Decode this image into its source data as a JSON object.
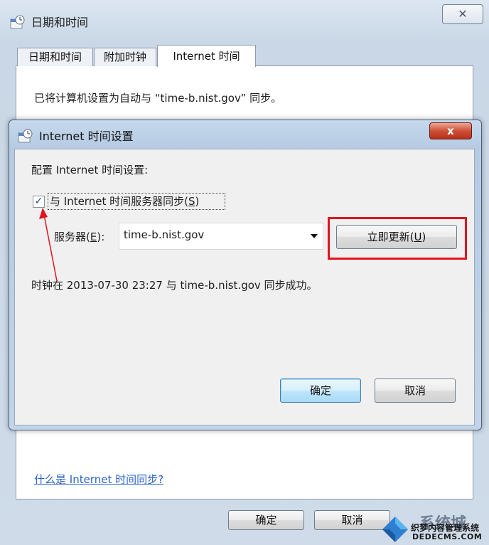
{
  "outer_dialog": {
    "title": "日期和时间",
    "close_symbol": "✕",
    "tabs": [
      {
        "label": "日期和时间"
      },
      {
        "label": "附加时钟"
      },
      {
        "label": "Internet 时间"
      }
    ],
    "sync_description": "已将计算机设置为自动与 “time-b.nist.gov” 同步。",
    "help_link": "什么是 Internet 时间同步?",
    "ok_label": "确定",
    "cancel_label": "取消"
  },
  "inner_dialog": {
    "title": "Internet 时间设置",
    "close_symbol": "x",
    "config_label": "配置 Internet 时间设置:",
    "sync_checkbox": {
      "checked": true,
      "label_prefix": "与 Internet 时间服务器同步(",
      "label_key": "S",
      "label_suffix": ")"
    },
    "server": {
      "label_prefix": "服务器(",
      "label_key": "E",
      "label_suffix": "):",
      "value": "time-b.nist.gov"
    },
    "update_button": {
      "label_prefix": "立即更新(",
      "label_key": "U",
      "label_suffix": ")"
    },
    "status_text": "时钟在 2013-07-30 23:27 与 time-b.nist.gov 同步成功。",
    "ok_label": "确定",
    "cancel_label": "取消"
  },
  "annotations": {
    "highlight_color": "#e0141e",
    "arrow_color": "#e0141e"
  },
  "watermark": {
    "brand": "系统城",
    "line1": "织梦内容管理系统",
    "line2": "DEDECMS.COM"
  }
}
